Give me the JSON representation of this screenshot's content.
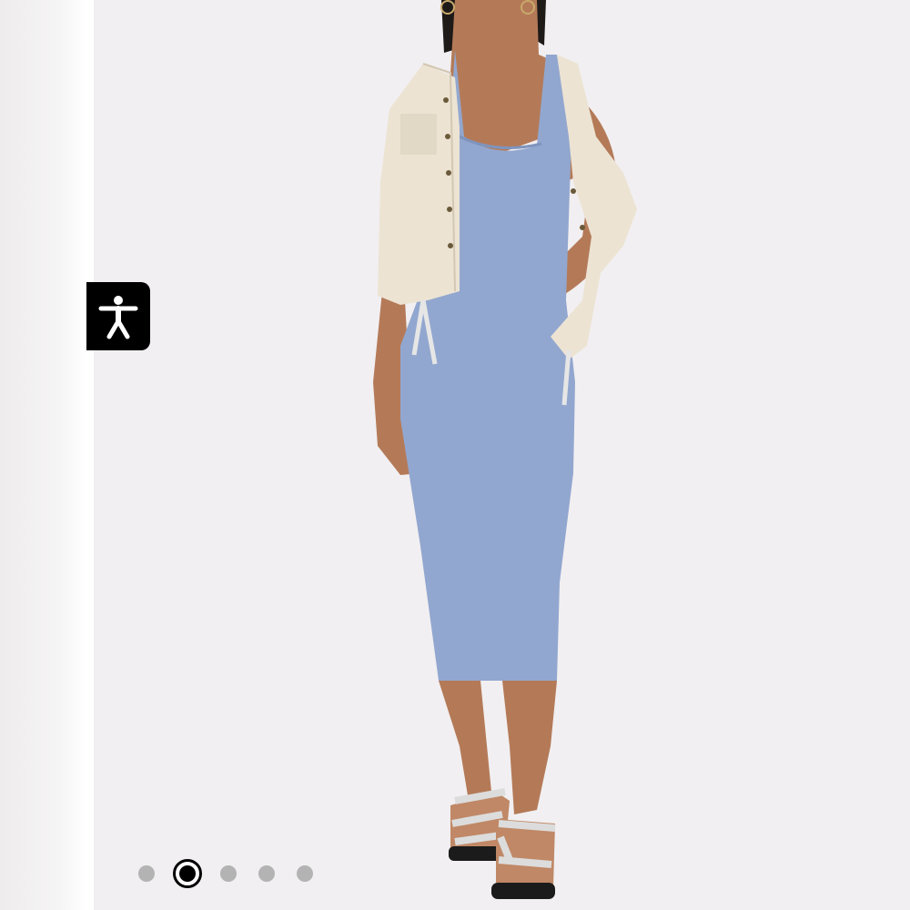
{
  "gallery": {
    "image_subject": "model-wearing-blue-dress-and-jacket",
    "dot_count": 5,
    "active_index": 1
  },
  "accessibility": {
    "icon": "accessibility-person-icon"
  },
  "colors": {
    "background": "#f1eff1",
    "dress": "#92a7cf",
    "jacket": "#ece3d3",
    "accent": "#000000"
  }
}
